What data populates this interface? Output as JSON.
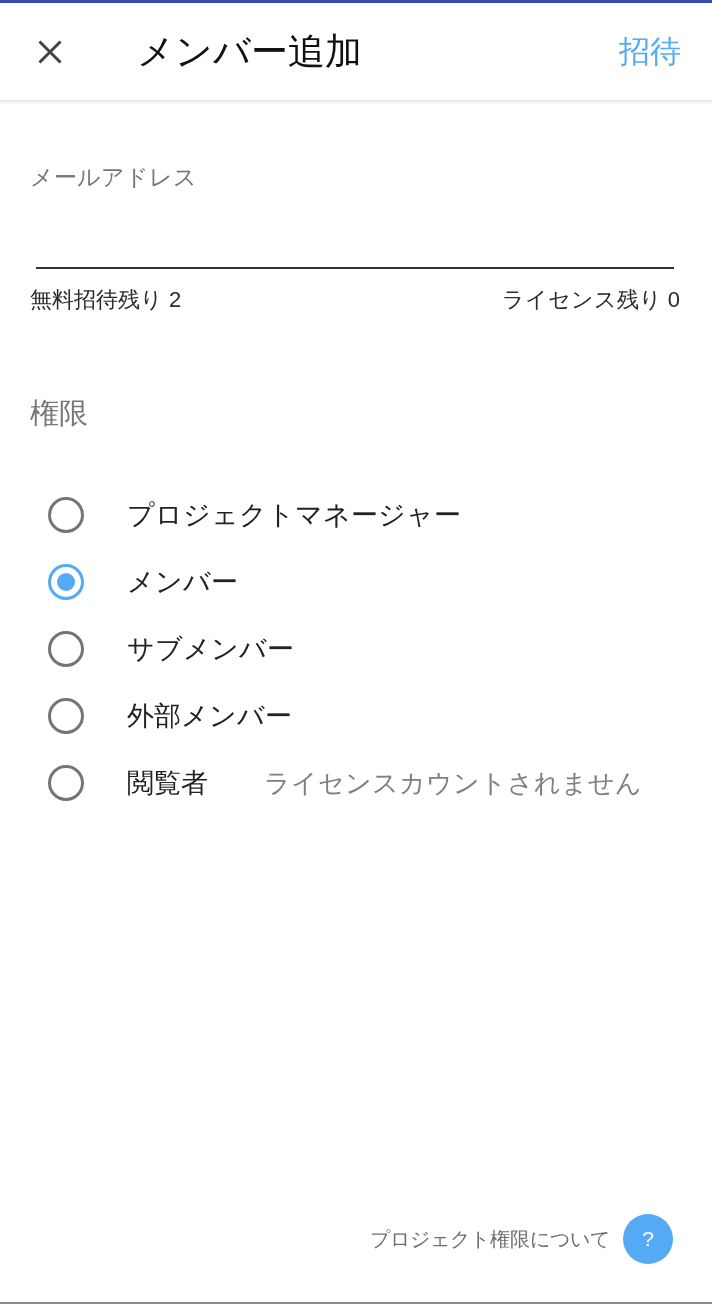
{
  "header": {
    "title": "メンバー追加",
    "action": "招待"
  },
  "email_field": {
    "label": "メールアドレス"
  },
  "counters": {
    "free_invites": "無料招待残り 2",
    "licenses": "ライセンス残り 0"
  },
  "permission": {
    "heading": "権限",
    "options": [
      {
        "label": "プロジェクトマネージャー",
        "selected": false
      },
      {
        "label": "メンバー",
        "selected": true
      },
      {
        "label": "サブメンバー",
        "selected": false
      },
      {
        "label": "外部メンバー",
        "selected": false
      },
      {
        "label": "閲覧者",
        "note": "ライセンスカウントされません",
        "selected": false
      }
    ]
  },
  "footer": {
    "help_text": "プロジェクト権限について",
    "help_button": "?"
  }
}
